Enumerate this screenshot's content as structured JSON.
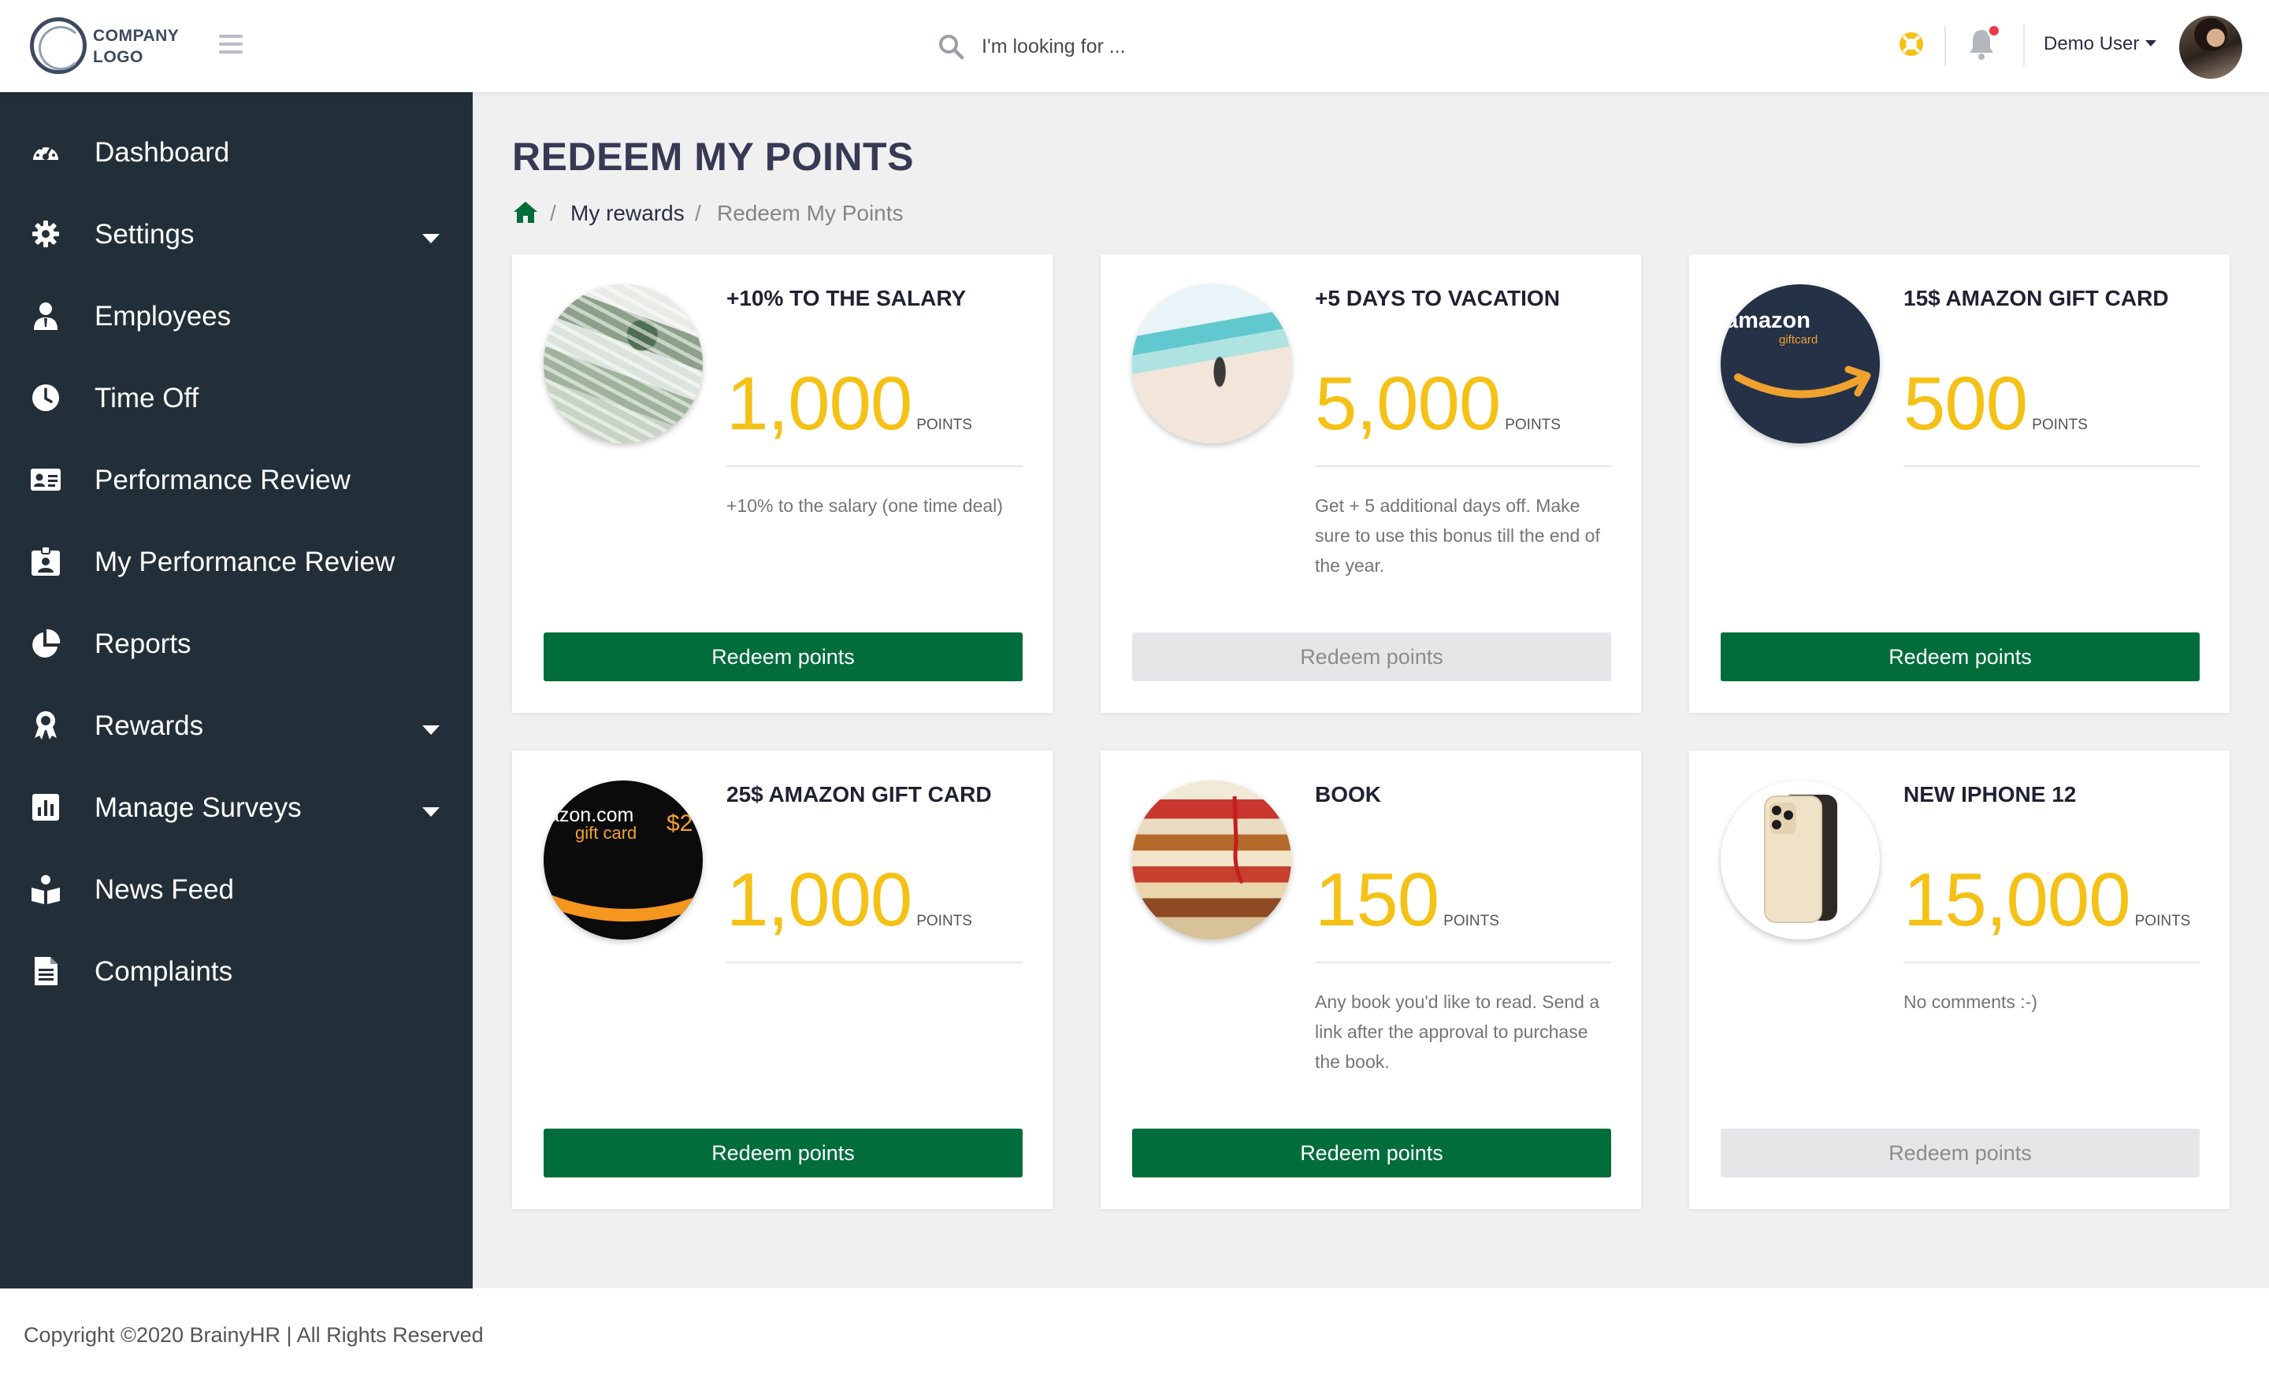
{
  "header": {
    "logo_line1": "COMPANY",
    "logo_line2": "LOGO",
    "search_placeholder": "I'm looking for ...",
    "user_name": "Demo User",
    "icons": [
      "menu-icon",
      "search-icon",
      "help-icon",
      "bell-icon",
      "avatar"
    ]
  },
  "sidebar": {
    "items": [
      {
        "label": "Dashboard",
        "icon": "dashboard-icon",
        "has_caret": false
      },
      {
        "label": "Settings",
        "icon": "gear-icon",
        "has_caret": true
      },
      {
        "label": "Employees",
        "icon": "employee-icon",
        "has_caret": false
      },
      {
        "label": "Time Off",
        "icon": "clock-icon",
        "has_caret": false
      },
      {
        "label": "Performance Review",
        "icon": "id-card-icon",
        "has_caret": false
      },
      {
        "label": "My Performance Review",
        "icon": "id-badge-icon",
        "has_caret": false
      },
      {
        "label": "Reports",
        "icon": "pie-chart-icon",
        "has_caret": false
      },
      {
        "label": "Rewards",
        "icon": "award-icon",
        "has_caret": true
      },
      {
        "label": "Manage Surveys",
        "icon": "bar-chart-icon",
        "has_caret": true
      },
      {
        "label": "News Feed",
        "icon": "book-reader-icon",
        "has_caret": false
      },
      {
        "label": "Complaints",
        "icon": "document-icon",
        "has_caret": false
      }
    ]
  },
  "page": {
    "title": "REDEEM MY POINTS",
    "breadcrumb": [
      "My rewards",
      "Redeem My Points"
    ],
    "breadcrumb_sep": "/"
  },
  "rewards": [
    {
      "title": "+10% TO THE SALARY",
      "points": "1,000",
      "unit": "POINTS",
      "description": "+10% to the salary (one time deal)",
      "button": "Redeem points",
      "enabled": true,
      "image": "money"
    },
    {
      "title": "+5 DAYS TO VACATION",
      "points": "5,000",
      "unit": "POINTS",
      "description": "Get + 5 additional days off. Make sure to use this bonus till the end of the year.",
      "button": "Redeem points",
      "enabled": false,
      "image": "beach"
    },
    {
      "title": "15$ AMAZON GIFT CARD",
      "points": "500",
      "unit": "POINTS",
      "description": "",
      "button": "Redeem points",
      "enabled": true,
      "image": "amazon-giftcard-dark",
      "image_text": [
        "amazon",
        "giftcard"
      ]
    },
    {
      "title": "25$ AMAZON GIFT CARD",
      "points": "1,000",
      "unit": "POINTS",
      "description": "",
      "button": "Redeem points",
      "enabled": true,
      "image": "amazon-giftcard-black",
      "image_text": [
        "azon.com",
        "gift card",
        "$2"
      ]
    },
    {
      "title": "BOOK",
      "points": "150",
      "unit": "POINTS",
      "description": "Any book you'd like to read. Send a link after the approval to purchase the book.",
      "button": "Redeem points",
      "enabled": true,
      "image": "books"
    },
    {
      "title": "NEW IPHONE 12",
      "points": "15,000",
      "unit": "POINTS",
      "description": "No comments :-)",
      "button": "Redeem points",
      "enabled": false,
      "image": "iphone"
    }
  ],
  "footer": {
    "text": "Copyright ©2020 BrainyHR | All Rights Reserved"
  },
  "colors": {
    "sidebar_bg": "#232f38",
    "accent_green": "#006d3b",
    "points_yellow": "#f5c116",
    "page_bg": "#f0f0f0",
    "notification_red": "#f0364a",
    "help_yellow": "#f5c116"
  }
}
